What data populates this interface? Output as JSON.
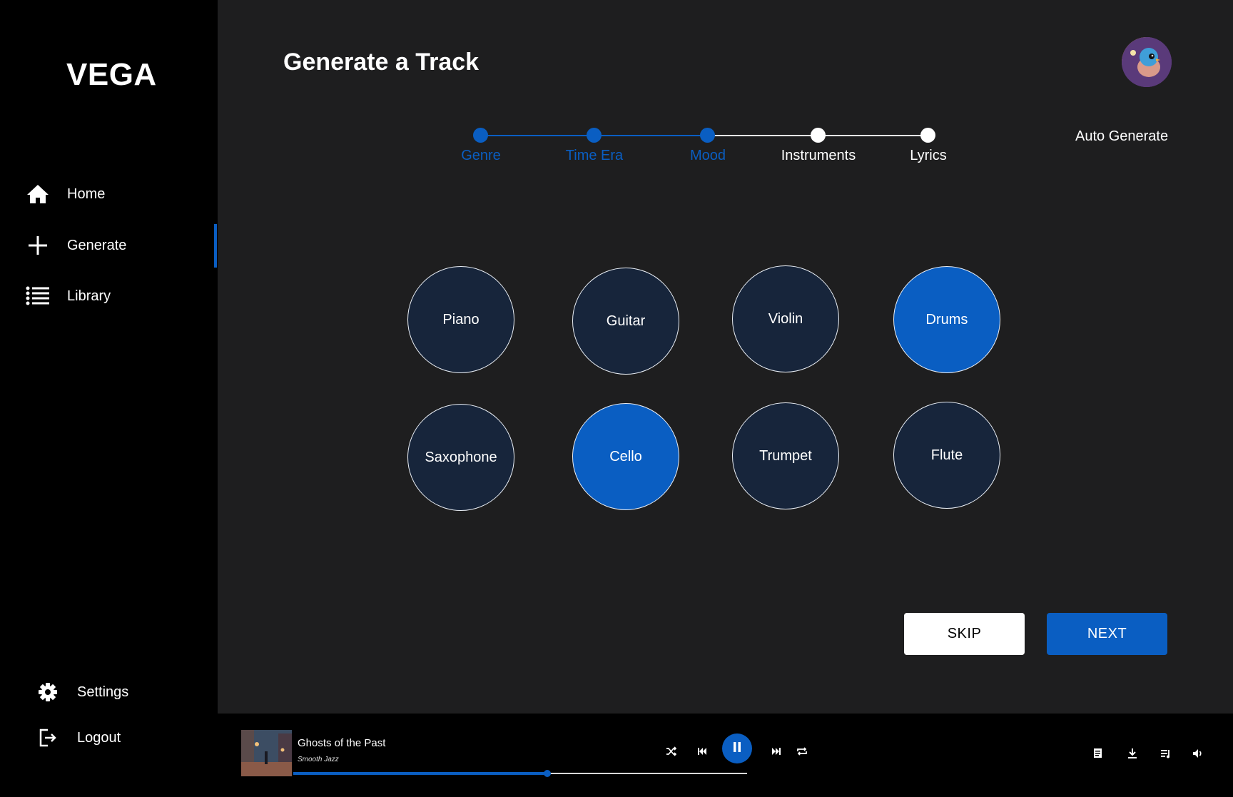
{
  "app": {
    "name": "VEGA"
  },
  "sidebar": {
    "items": [
      {
        "label": "Home",
        "icon": "home-icon"
      },
      {
        "label": "Generate",
        "icon": "plus-icon",
        "active": true
      },
      {
        "label": "Library",
        "icon": "list-icon"
      }
    ],
    "bottom": [
      {
        "label": "Settings",
        "icon": "gear-icon"
      },
      {
        "label": "Logout",
        "icon": "logout-icon"
      }
    ]
  },
  "header": {
    "title": "Generate a Track",
    "auto_generate_label": "Auto Generate"
  },
  "steps": [
    {
      "label": "Genre",
      "completed": true
    },
    {
      "label": "Time Era",
      "completed": true
    },
    {
      "label": "Mood",
      "completed": true
    },
    {
      "label": "Instruments",
      "completed": false
    },
    {
      "label": "Lyrics",
      "completed": false
    }
  ],
  "instruments": [
    {
      "label": "Piano",
      "selected": false
    },
    {
      "label": "Guitar",
      "selected": false
    },
    {
      "label": "Violin",
      "selected": false
    },
    {
      "label": "Drums",
      "selected": true
    },
    {
      "label": "Saxophone",
      "selected": false
    },
    {
      "label": "Cello",
      "selected": true
    },
    {
      "label": "Trumpet",
      "selected": false
    },
    {
      "label": "Flute",
      "selected": false
    }
  ],
  "actions": {
    "skip_label": "SKIP",
    "next_label": "NEXT"
  },
  "player": {
    "track_title": "Ghosts of the Past",
    "track_genre": "Smooth Jazz",
    "progress": 0.56,
    "state": "playing"
  },
  "colors": {
    "accent": "#0a5ec2",
    "background": "#1e1e1f",
    "circle": "#17253b"
  }
}
